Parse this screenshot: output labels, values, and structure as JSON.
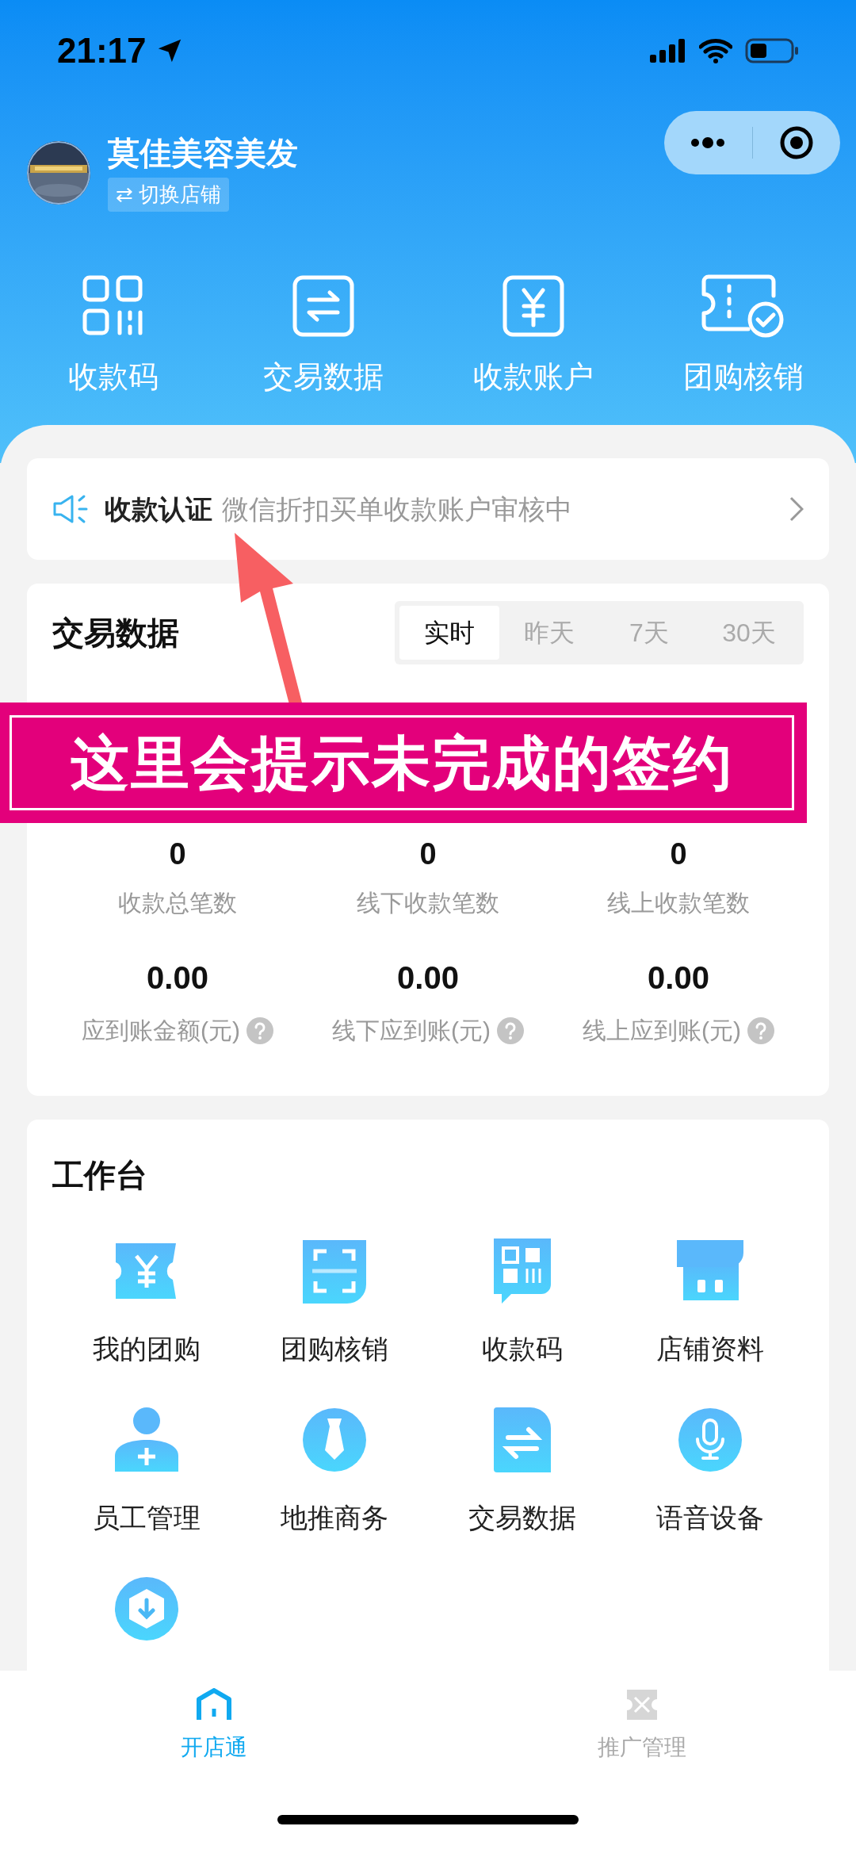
{
  "status_bar": {
    "time": "21:17"
  },
  "store": {
    "name": "莫佳美容美发",
    "switch_label": "⇄ 切换店铺"
  },
  "quick_actions": [
    {
      "kind": "qr",
      "label": "收款码"
    },
    {
      "kind": "exchange",
      "label": "交易数据"
    },
    {
      "kind": "yuan",
      "label": "收款账户"
    },
    {
      "kind": "ticket",
      "label": "团购核销"
    }
  ],
  "notice": {
    "title": "收款认证",
    "message": "微信折扣买单收款账户审核中"
  },
  "annotation": {
    "text": "这里会提示未完成的签约"
  },
  "trade_data": {
    "title": "交易数据",
    "tabs": [
      {
        "label": "实时",
        "selected": true
      },
      {
        "label": "昨天",
        "selected": false
      },
      {
        "label": "7天",
        "selected": false
      },
      {
        "label": "30天",
        "selected": false
      }
    ],
    "counts": [
      {
        "value": "0",
        "label": "收款总笔数"
      },
      {
        "value": "0",
        "label": "线下收款笔数"
      },
      {
        "value": "0",
        "label": "线上收款笔数"
      }
    ],
    "amounts": [
      {
        "value": "0.00",
        "label": "应到账金额(元)"
      },
      {
        "value": "0.00",
        "label": "线下应到账(元)"
      },
      {
        "value": "0.00",
        "label": "线上应到账(元)"
      }
    ]
  },
  "workbench": {
    "title": "工作台",
    "items": [
      {
        "kind": "coupon",
        "label": "我的团购"
      },
      {
        "kind": "scan",
        "label": "团购核销"
      },
      {
        "kind": "qrcode",
        "label": "收款码"
      },
      {
        "kind": "store",
        "label": "店铺资料"
      },
      {
        "kind": "staff",
        "label": "员工管理"
      },
      {
        "kind": "tie",
        "label": "地推商务"
      },
      {
        "kind": "doc",
        "label": "交易数据"
      },
      {
        "kind": "mic",
        "label": "语音设备"
      },
      {
        "kind": "download"
      }
    ]
  },
  "tab_bar": [
    {
      "kind": "home",
      "label": "开店通",
      "selected": true
    },
    {
      "kind": "promo",
      "label": "推广管理",
      "selected": false
    }
  ]
}
